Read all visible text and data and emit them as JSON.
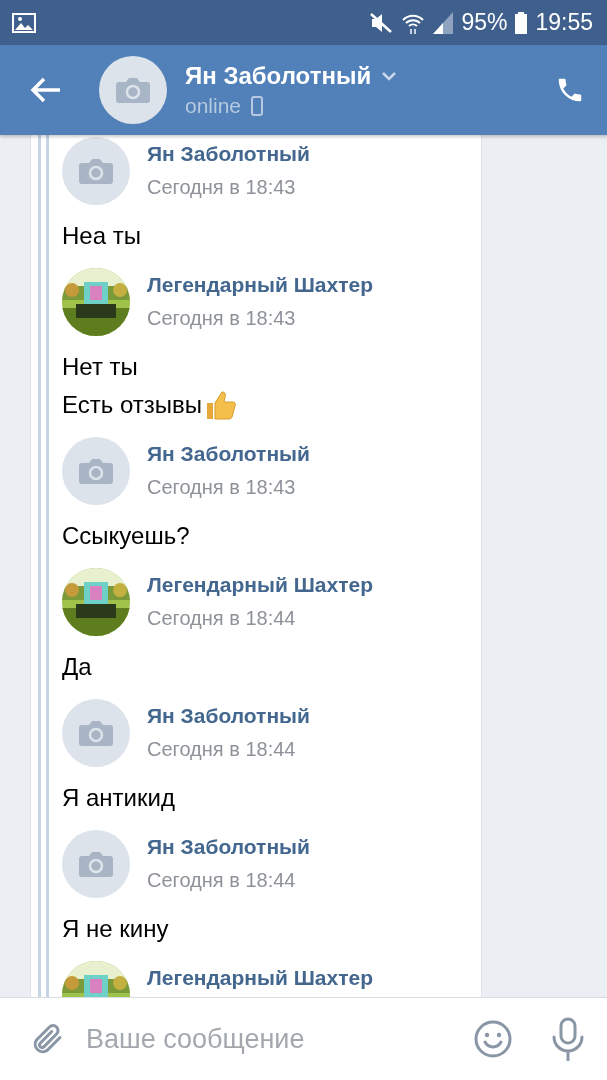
{
  "status_bar": {
    "battery": "95%",
    "time": "19:55"
  },
  "header": {
    "name": "Ян Заболотный",
    "status": "online"
  },
  "messages": [
    {
      "author": "Ян Заболотный",
      "kind": "placeholder",
      "time": "Сегодня в 18:43",
      "lines": [
        {
          "text": "Неа ты",
          "kind": "plain"
        }
      ]
    },
    {
      "author": "Легендарный Шахтер",
      "kind": "picture",
      "time": "Сегодня в 18:43",
      "lines": [
        {
          "text": "Нет ты",
          "kind": "plain"
        },
        {
          "text": "Есть отзывы",
          "kind": "emoji"
        }
      ]
    },
    {
      "author": "Ян Заболотный",
      "kind": "placeholder",
      "time": "Сегодня в 18:43",
      "lines": [
        {
          "text": "Ссыкуешь?",
          "kind": "plain"
        }
      ]
    },
    {
      "author": "Легендарный Шахтер",
      "kind": "picture",
      "time": "Сегодня в 18:44",
      "lines": [
        {
          "text": "Да",
          "kind": "plain"
        }
      ]
    },
    {
      "author": "Ян Заболотный",
      "kind": "placeholder",
      "time": "Сегодня в 18:44",
      "lines": [
        {
          "text": "Я антикид",
          "kind": "plain"
        }
      ]
    },
    {
      "author": "Ян Заболотный",
      "kind": "placeholder",
      "time": "Сегодня в 18:44",
      "lines": [
        {
          "text": "Я не кину",
          "kind": "plain"
        }
      ]
    },
    {
      "author": "Легендарный Шахтер",
      "kind": "picture"
    }
  ],
  "composer": {
    "placeholder": "Ваше сообщение"
  }
}
